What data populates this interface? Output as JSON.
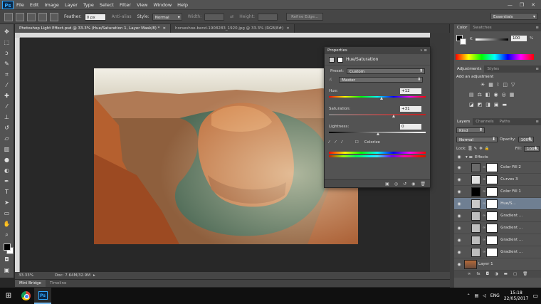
{
  "menu": {
    "logo": "Ps",
    "items": [
      "File",
      "Edit",
      "Image",
      "Layer",
      "Type",
      "Select",
      "Filter",
      "View",
      "Window",
      "Help"
    ],
    "controls": [
      "—",
      "❐",
      "✕"
    ]
  },
  "options": {
    "feather_label": "Feather:",
    "feather_value": "0 px",
    "antialias_label": "Anti-alias",
    "style_label": "Style:",
    "style_value": "Normal",
    "width_label": "Width:",
    "height_label": "Height:",
    "refine_label": "Refine Edge...",
    "workspace": "Essentials"
  },
  "tabs": [
    {
      "label": "Photoshop Light Effect.psd @ 33.3% (Hue/Saturation 1, Layer Mask/8) *",
      "close": "×"
    },
    {
      "label": "horseshoe-bend-1908283_1920.jpg @ 33.3% (RGB/8#)",
      "close": "×"
    }
  ],
  "status": {
    "zoom": "33.33%",
    "doc": "Doc: 7.64M/32.9M"
  },
  "bottom_tabs": [
    "Mini Bridge",
    "Timeline"
  ],
  "properties": {
    "header": "Properties",
    "title": "Hue/Saturation",
    "preset_label": "Preset:",
    "preset_value": "Custom",
    "channel_value": "Master",
    "hue_label": "Hue:",
    "hue_value": "+12",
    "hue_fraction": 0.54,
    "sat_label": "Saturation:",
    "sat_value": "+31",
    "sat_fraction": 0.66,
    "light_label": "Lightness:",
    "light_value": "0",
    "light_fraction": 0.5,
    "colorize_label": "Colorize"
  },
  "color_panel": {
    "tabs": [
      "Color",
      "Swatches"
    ],
    "channel": "K",
    "value": "100",
    "unit": "%"
  },
  "adjustments_panel": {
    "tabs": [
      "Adjustments",
      "Styles"
    ],
    "heading": "Add an adjustment"
  },
  "layers_panel": {
    "tabs": [
      "Layers",
      "Channels",
      "Paths"
    ],
    "kind_label": "Kind",
    "blend_mode": "Normal",
    "opacity_label": "Opacity:",
    "opacity_value": "100%",
    "lock_label": "Lock:",
    "fill_label": "Fill:",
    "fill_value": "100%",
    "group_name": "Effects",
    "layers": [
      {
        "name": "Color Fill 2",
        "thumb": "#6a6a6a",
        "selected": false
      },
      {
        "name": "Curves 3",
        "thumb": "#e0e0e0",
        "selected": false
      },
      {
        "name": "Color Fill 1",
        "thumb": "#000000",
        "selected": false
      },
      {
        "name": "Hue/S...",
        "thumb": "#c9c9c9",
        "selected": true
      },
      {
        "name": "Gradient ...",
        "thumb": "#bdbdbd",
        "selected": false
      },
      {
        "name": "Gradient ...",
        "thumb": "#bdbdbd",
        "selected": false
      },
      {
        "name": "Gradient ...",
        "thumb": "#bdbdbd",
        "selected": false
      },
      {
        "name": "Gradient ...",
        "thumb": "#bdbdbd",
        "selected": false
      }
    ],
    "base_layer": "Layer 1"
  },
  "taskbar": {
    "lang": "ENG",
    "time": "15:18",
    "date": "22/05/2017"
  },
  "colors": {
    "accent": "#31a8ff",
    "panel": "#535353",
    "selected_layer": "#6f7f92"
  }
}
